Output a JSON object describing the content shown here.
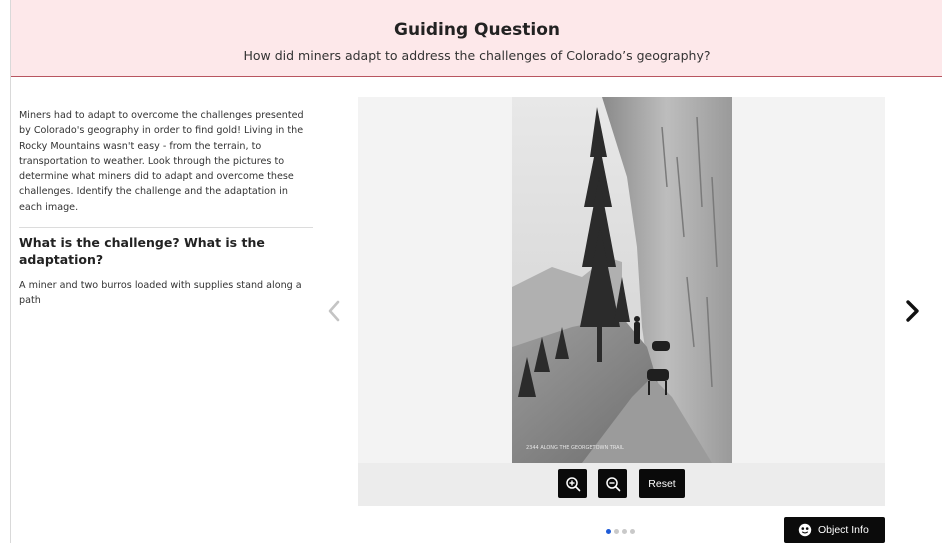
{
  "header": {
    "title": "Guiding Question",
    "question": "How did miners adapt to address the challenges of Colorado’s geography?"
  },
  "left_panel": {
    "intro": "Miners had to adapt to overcome the challenges presented by Colorado's geography in order to find gold! Living in the Rocky Mountains wasn't easy - from the terrain, to transportation to weather. Look through the pictures to determine what miners did to adapt and overcome these challenges. Identify the challenge and the adaptation in each image.",
    "heading": "What is the challenge? What is the adaptation?",
    "caption": "A miner and two burros loaded with supplies stand along a path"
  },
  "viewer": {
    "photo_inscription": "2344  ALONG THE GEORGETOWN TRAIL",
    "controls": {
      "zoom_in_icon": "zoom-in-icon",
      "zoom_out_icon": "zoom-out-icon",
      "reset_label": "Reset"
    }
  },
  "navigation": {
    "prev_icon": "chevron-left-icon",
    "next_icon": "chevron-right-icon",
    "slide_count": 4,
    "active_slide": 1
  },
  "object_info": {
    "label": "Object Info",
    "icon": "info-icon"
  },
  "colors": {
    "header_bg": "#fde8ea",
    "header_border": "#b85560",
    "active_dot": "#1e5bd8",
    "control_bg": "#0a0a0a"
  }
}
